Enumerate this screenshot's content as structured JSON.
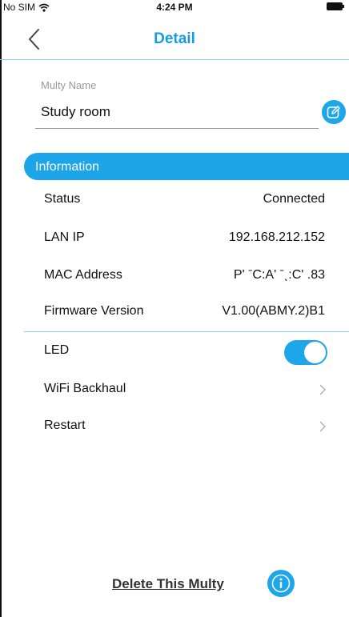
{
  "status_bar": {
    "carrier": "No SIM",
    "time": "4:24 PM",
    "wifi_icon": "wifi-icon",
    "battery_icon": "battery-icon"
  },
  "nav": {
    "title": "Detail",
    "back_icon": "chevron-left-icon"
  },
  "name_field": {
    "label": "Multy Name",
    "value": "Study room",
    "edit_icon": "edit-icon"
  },
  "information": {
    "header": "Information",
    "rows": [
      {
        "label": "Status",
        "value": "Connected"
      },
      {
        "label": "LAN IP",
        "value": "192.168.212.152"
      },
      {
        "label": "MAC Address",
        "value": "P' ˉC:A' ˉˎ:C' .83"
      },
      {
        "label": "Firmware Version",
        "value": "V1.00(ABMY.2)B1"
      }
    ]
  },
  "settings": {
    "led": {
      "label": "LED",
      "enabled": true
    },
    "wifi_backhaul": {
      "label": "WiFi Backhaul"
    },
    "restart": {
      "label": "Restart"
    }
  },
  "footer": {
    "delete_label": "Delete This Multy",
    "info_icon": "info-icon"
  },
  "colors": {
    "accent": "#1ea6ea",
    "title": "#169de0",
    "divider": "#8fcfee"
  }
}
